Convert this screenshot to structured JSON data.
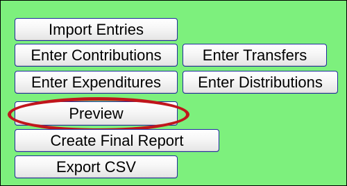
{
  "buttons": {
    "import_entries": "Import Entries",
    "enter_contributions": "Enter Contributions",
    "enter_transfers": "Enter Transfers",
    "enter_expenditures": "Enter Expenditures",
    "enter_distributions": "Enter Distributions",
    "preview": "Preview",
    "create_final_report": "Create Final Report",
    "export_csv": "Export CSV"
  },
  "colors": {
    "panel_background": "#7df07d",
    "button_border": "#1e2b9c",
    "highlight_ring": "#c0161c"
  }
}
